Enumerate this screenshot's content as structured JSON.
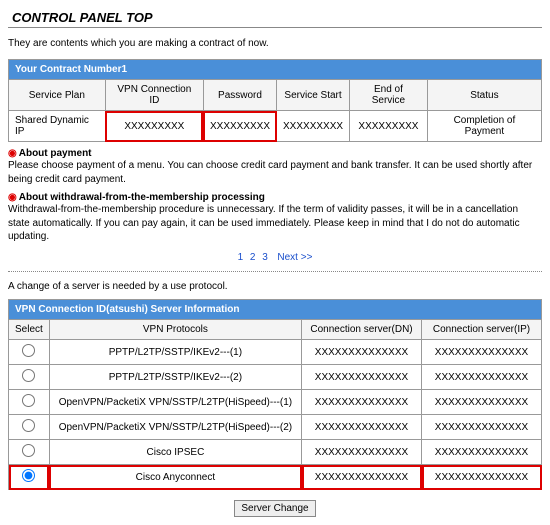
{
  "page_title": "CONTROL PANEL TOP",
  "intro": "They are contents which you are making a contract of now.",
  "contract": {
    "section_title": "Your Contract Number1",
    "headers": {
      "plan": "Service Plan",
      "vpn_id": "VPN Connection ID",
      "password": "Password",
      "start": "Service Start",
      "end": "End of Service",
      "status": "Status"
    },
    "row": {
      "plan": "Shared Dynamic IP",
      "vpn_id": "XXXXXXXXX",
      "password": "XXXXXXXXX",
      "start": "XXXXXXXXX",
      "end": "XXXXXXXXX",
      "status": "Completion of Payment"
    }
  },
  "notes": {
    "payment_title": "About payment",
    "payment_body": "Please choose payment of a menu. You can choose credit card payment and bank transfer. It can be used shortly after being credit card payment.",
    "withdraw_title": "About withdrawal-from-the-membership processing",
    "withdraw_body": "Withdrawal-from-the-membership procedure is unnecessary. If the term of validity passes, it will be in a cancellation state automatically. If you can pay again, it can be used immediately. Please keep in mind that I do not do automatic updating."
  },
  "pager": {
    "p1": "1",
    "p2": "2",
    "p3": "3",
    "next": "Next >>"
  },
  "change_note": "A change of a server is needed by a use protocol.",
  "server": {
    "section_title": "VPN Connection ID(atsushi) Server Information",
    "headers": {
      "select": "Select",
      "protocols": "VPN Protocols",
      "dn": "Connection server(DN)",
      "ip": "Connection server(IP)"
    },
    "rows": [
      {
        "proto": "PPTP/L2TP/SSTP/IKEv2---(1)",
        "dn": "XXXXXXXXXXXXXX",
        "ip": "XXXXXXXXXXXXXX",
        "selected": false
      },
      {
        "proto": "PPTP/L2TP/SSTP/IKEv2---(2)",
        "dn": "XXXXXXXXXXXXXX",
        "ip": "XXXXXXXXXXXXXX",
        "selected": false
      },
      {
        "proto": "OpenVPN/PacketiX VPN/SSTP/L2TP(HiSpeed)---(1)",
        "dn": "XXXXXXXXXXXXXX",
        "ip": "XXXXXXXXXXXXXX",
        "selected": false
      },
      {
        "proto": "OpenVPN/PacketiX VPN/SSTP/L2TP(HiSpeed)---(2)",
        "dn": "XXXXXXXXXXXXXX",
        "ip": "XXXXXXXXXXXXXX",
        "selected": false
      },
      {
        "proto": "Cisco IPSEC",
        "dn": "XXXXXXXXXXXXXX",
        "ip": "XXXXXXXXXXXXXX",
        "selected": false
      },
      {
        "proto": "Cisco Anyconnect",
        "dn": "XXXXXXXXXXXXXX",
        "ip": "XXXXXXXXXXXXXX",
        "selected": true,
        "highlight": true
      }
    ]
  },
  "server_change_label": "Server Change"
}
